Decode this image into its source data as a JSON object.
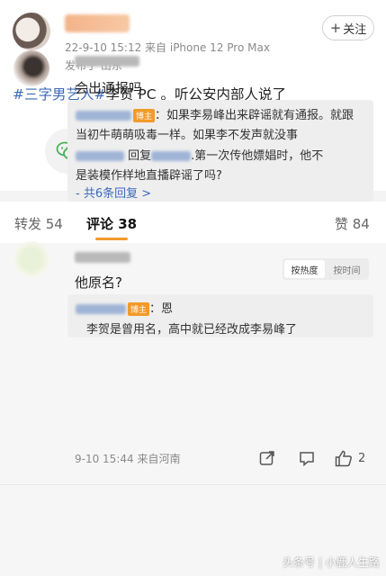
{
  "post": {
    "meta_time": "22-9-10 15:12  来自 iPhone 12 Pro Max",
    "meta_loc": "发布于 山东",
    "follow_label": "关注",
    "hashtag": "#三字男艺人#",
    "body_text": "李贺 PC 。听公安内部人说了"
  },
  "share_icons": [
    "wechat-icon",
    "moments-icon",
    "qq-icon",
    "save-icon"
  ],
  "tabs": {
    "repost": "转发 54",
    "comment": "评论 38",
    "like": "赞 84"
  },
  "sort": {
    "hot": "按热度",
    "time": "按时间"
  },
  "comments": [
    {
      "text": "会出通报吗",
      "op_badge": "博主",
      "reply1_line1": "：如果李易峰出来辟谣就有通报。就跟",
      "reply1_line2": "当初牛萌萌吸毒一样。如果李不发声就没事",
      "reply2_mid": "回复",
      "reply2_tail": ".第一次传他嫖娼时，他不",
      "reply2_line2": "是装模作样地直播辟谣了吗?",
      "more": "- 共6条回复 >",
      "footer": "9-10 15:44  来自河南",
      "likes": "2"
    },
    {
      "text": "他原名?",
      "op_badge": "博主",
      "reply_line1": "：恩",
      "reply_line2": "李贺是曾用名，高中就已经改成李易峰了"
    }
  ],
  "watermark": "头条号 | 小鹿人生路",
  "colors": {
    "accent": "#f29a2a",
    "link": "#3c6ab8",
    "wechat": "#49b25a",
    "moments": "#7bbf4d",
    "qq": "#3d8bd6",
    "save": "#f2a93b"
  }
}
